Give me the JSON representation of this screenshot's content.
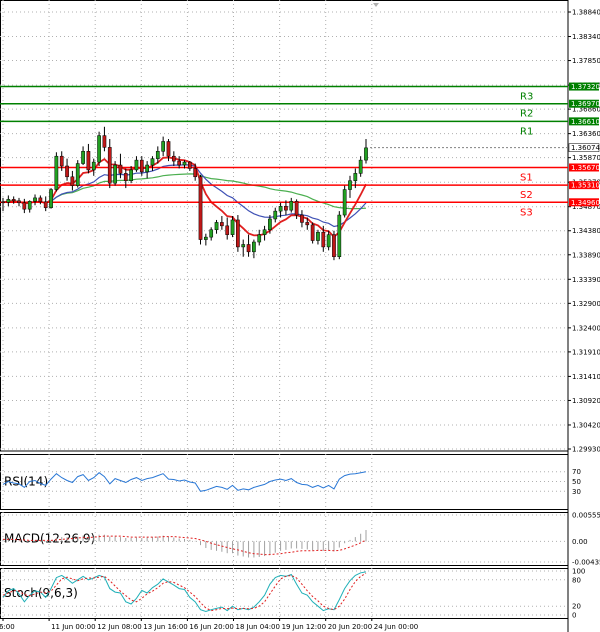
{
  "chart_data": {
    "type": "candlestick",
    "price_axis": {
      "ticks": [
        "1.38840",
        "1.38340",
        "1.37850",
        "1.37350",
        "1.36860",
        "1.36360",
        "1.35870",
        "1.35370",
        "1.34870",
        "1.34380",
        "1.33890",
        "1.33390",
        "1.32900",
        "1.32400",
        "1.31910",
        "1.31410",
        "1.30920",
        "1.30420",
        "1.29930"
      ],
      "ylim": [
        1.2993,
        1.3884
      ]
    },
    "time_axis": {
      "ticks": [
        "6:00",
        "11 Jun 00:00",
        "12 Jun 08:00",
        "13 Jun 16:00",
        "16 Jun 20:00",
        "18 Jun 04:00",
        "19 Jun 12:00",
        "20 Jun 20:00",
        "24 Jun 00:00"
      ]
    },
    "current_price": "1.36074",
    "levels": [
      {
        "name": "R3",
        "price": 1.3732,
        "label": "1.37320",
        "color": "#008000"
      },
      {
        "name": "R2",
        "price": 1.3697,
        "label": "1.36970",
        "color": "#008000"
      },
      {
        "name": "R1",
        "price": 1.3661,
        "label": "1.36610",
        "color": "#008000"
      },
      {
        "name": "S1",
        "price": 1.3567,
        "label": "1.35670",
        "color": "#ff0000"
      },
      {
        "name": "S2",
        "price": 1.3531,
        "label": "1.35310",
        "color": "#ff0000"
      },
      {
        "name": "S3",
        "price": 1.3496,
        "label": "1.34960",
        "color": "#ff0000"
      }
    ],
    "candles": [
      [
        1.3497,
        1.3505,
        1.3478,
        1.3496
      ],
      [
        1.3496,
        1.351,
        1.3488,
        1.3502
      ],
      [
        1.3502,
        1.3508,
        1.3493,
        1.3499
      ],
      [
        1.3499,
        1.3505,
        1.3488,
        1.3495
      ],
      [
        1.3495,
        1.3503,
        1.3474,
        1.3482
      ],
      [
        1.3482,
        1.35,
        1.3475,
        1.3498
      ],
      [
        1.3498,
        1.3512,
        1.349,
        1.3505
      ],
      [
        1.3505,
        1.351,
        1.3492,
        1.3497
      ],
      [
        1.3497,
        1.3508,
        1.3478,
        1.3485
      ],
      [
        1.3485,
        1.3525,
        1.3483,
        1.3522
      ],
      [
        1.3522,
        1.3598,
        1.3518,
        1.359
      ],
      [
        1.359,
        1.36,
        1.356,
        1.357
      ],
      [
        1.357,
        1.3585,
        1.354,
        1.3548
      ],
      [
        1.3548,
        1.356,
        1.352,
        1.353
      ],
      [
        1.353,
        1.3582,
        1.3526,
        1.3575
      ],
      [
        1.3575,
        1.361,
        1.3572,
        1.36
      ],
      [
        1.36,
        1.3615,
        1.3555,
        1.3562
      ],
      [
        1.3562,
        1.3585,
        1.355,
        1.3578
      ],
      [
        1.3578,
        1.364,
        1.357,
        1.3632
      ],
      [
        1.3632,
        1.365,
        1.36,
        1.3608
      ],
      [
        1.3608,
        1.3625,
        1.3525,
        1.3535
      ],
      [
        1.3535,
        1.358,
        1.353,
        1.3572
      ],
      [
        1.3572,
        1.3595,
        1.3545,
        1.3555
      ],
      [
        1.3555,
        1.3565,
        1.3525,
        1.354
      ],
      [
        1.354,
        1.357,
        1.3535,
        1.3562
      ],
      [
        1.3562,
        1.359,
        1.3558,
        1.3582
      ],
      [
        1.3582,
        1.359,
        1.355,
        1.3558
      ],
      [
        1.3558,
        1.358,
        1.3545,
        1.3572
      ],
      [
        1.3572,
        1.359,
        1.356,
        1.3585
      ],
      [
        1.3585,
        1.361,
        1.3575,
        1.36
      ],
      [
        1.36,
        1.363,
        1.359,
        1.362
      ],
      [
        1.362,
        1.3625,
        1.358,
        1.359
      ],
      [
        1.359,
        1.36,
        1.357,
        1.358
      ],
      [
        1.358,
        1.359,
        1.3565,
        1.3572
      ],
      [
        1.3572,
        1.3582,
        1.3565,
        1.3578
      ],
      [
        1.3578,
        1.358,
        1.356,
        1.3565
      ],
      [
        1.3565,
        1.3575,
        1.354,
        1.3548
      ],
      [
        1.3548,
        1.3552,
        1.341,
        1.342
      ],
      [
        1.342,
        1.3432,
        1.3408,
        1.3425
      ],
      [
        1.3425,
        1.3445,
        1.3418,
        1.344
      ],
      [
        1.344,
        1.346,
        1.3432,
        1.3455
      ],
      [
        1.3455,
        1.3468,
        1.344,
        1.3448
      ],
      [
        1.3448,
        1.3465,
        1.342,
        1.343
      ],
      [
        1.343,
        1.3468,
        1.3425,
        1.346
      ],
      [
        1.346,
        1.347,
        1.3395,
        1.3405
      ],
      [
        1.3405,
        1.342,
        1.3385,
        1.341
      ],
      [
        1.341,
        1.343,
        1.3385,
        1.3395
      ],
      [
        1.3395,
        1.342,
        1.3382,
        1.3415
      ],
      [
        1.3415,
        1.344,
        1.3408,
        1.343
      ],
      [
        1.343,
        1.3448,
        1.3418,
        1.344
      ],
      [
        1.344,
        1.347,
        1.3432,
        1.3462
      ],
      [
        1.3462,
        1.3485,
        1.3455,
        1.3478
      ],
      [
        1.3478,
        1.3495,
        1.3465,
        1.3488
      ],
      [
        1.3488,
        1.35,
        1.347,
        1.348
      ],
      [
        1.348,
        1.3505,
        1.3475,
        1.3498
      ],
      [
        1.3498,
        1.3502,
        1.3462,
        1.347
      ],
      [
        1.347,
        1.348,
        1.3445,
        1.3455
      ],
      [
        1.3455,
        1.3465,
        1.344,
        1.345
      ],
      [
        1.345,
        1.3455,
        1.3412,
        1.3418
      ],
      [
        1.3418,
        1.344,
        1.341,
        1.3435
      ],
      [
        1.3435,
        1.3448,
        1.3395,
        1.3405
      ],
      [
        1.3405,
        1.3438,
        1.3398,
        1.343
      ],
      [
        1.343,
        1.3438,
        1.3378,
        1.3385
      ],
      [
        1.3385,
        1.3478,
        1.338,
        1.347
      ],
      [
        1.347,
        1.353,
        1.3465,
        1.3522
      ],
      [
        1.3522,
        1.355,
        1.3505,
        1.354
      ],
      [
        1.354,
        1.3565,
        1.3525,
        1.3555
      ],
      [
        1.3555,
        1.359,
        1.3548,
        1.3582
      ],
      [
        1.3582,
        1.3625,
        1.3575,
        1.3607
      ]
    ],
    "indicators": [
      {
        "name": "RSI(14)",
        "ticks": [
          "70",
          "50",
          "30"
        ],
        "ylim": [
          0,
          100
        ],
        "values": [
          44,
          50,
          47,
          45,
          38,
          50,
          52,
          46,
          42,
          55,
          66,
          58,
          52,
          48,
          60,
          64,
          52,
          58,
          68,
          60,
          45,
          56,
          52,
          48,
          54,
          58,
          52,
          56,
          58,
          62,
          66,
          55,
          54,
          51,
          53,
          49,
          47,
          30,
          32,
          36,
          40,
          38,
          34,
          42,
          32,
          35,
          33,
          38,
          41,
          44,
          50,
          53,
          55,
          52,
          56,
          48,
          44,
          43,
          38,
          42,
          37,
          42,
          35,
          55,
          62,
          65,
          66,
          68,
          70
        ]
      },
      {
        "name": "MACD(12,26,9)",
        "ticks": [
          "0.005556",
          "0.00",
          "-0.004356"
        ],
        "ylim": [
          -0.004356,
          0.005556
        ],
        "histogram": [
          0.0004,
          0.0003,
          0.0003,
          0.0002,
          0.0001,
          0.0001,
          0.0002,
          0.0002,
          0.0001,
          0.0002,
          0.0007,
          0.0009,
          0.0009,
          0.0008,
          0.001,
          0.0012,
          0.001,
          0.001,
          0.0014,
          0.0014,
          0.001,
          0.001,
          0.0009,
          0.0007,
          0.0007,
          0.0008,
          0.0007,
          0.0008,
          0.0009,
          0.001,
          0.0012,
          0.001,
          0.0008,
          0.0006,
          0.0005,
          0.0003,
          0.0001,
          -0.0008,
          -0.0014,
          -0.0018,
          -0.002,
          -0.0022,
          -0.0025,
          -0.0025,
          -0.003,
          -0.0032,
          -0.0034,
          -0.0034,
          -0.0033,
          -0.0031,
          -0.0028,
          -0.0024,
          -0.002,
          -0.0018,
          -0.0015,
          -0.0015,
          -0.0016,
          -0.0017,
          -0.0019,
          -0.0018,
          -0.002,
          -0.0019,
          -0.0021,
          -0.0013,
          -0.0004,
          0.0003,
          0.0009,
          0.0016,
          0.0024
        ],
        "signal": [
          0.0004,
          0.0004,
          0.0004,
          0.0003,
          0.0003,
          0.0002,
          0.0002,
          0.0002,
          0.0002,
          0.0002,
          0.0003,
          0.0004,
          0.0005,
          0.0006,
          0.0007,
          0.0008,
          0.0008,
          0.0009,
          0.001,
          0.0011,
          0.0011,
          0.0011,
          0.0011,
          0.001,
          0.0009,
          0.0009,
          0.0009,
          0.0009,
          0.0009,
          0.0009,
          0.001,
          0.001,
          0.001,
          0.0009,
          0.0008,
          0.0007,
          0.0006,
          0.0003,
          0.0,
          -0.0004,
          -0.0007,
          -0.001,
          -0.0013,
          -0.0016,
          -0.0018,
          -0.0021,
          -0.0024,
          -0.0026,
          -0.0027,
          -0.0028,
          -0.0028,
          -0.0027,
          -0.0026,
          -0.0024,
          -0.0023,
          -0.0021,
          -0.002,
          -0.002,
          -0.002,
          -0.0019,
          -0.0019,
          -0.0019,
          -0.002,
          -0.0019,
          -0.0016,
          -0.0012,
          -0.0008,
          -0.0003,
          0.0003
        ]
      },
      {
        "name": "Stoch(9,6,3)",
        "ticks": [
          "100",
          "80",
          "20",
          "0"
        ],
        "ylim": [
          0,
          100
        ],
        "main": [
          40,
          55,
          60,
          48,
          30,
          45,
          55,
          52,
          40,
          60,
          85,
          90,
          82,
          72,
          80,
          88,
          80,
          84,
          90,
          86,
          60,
          52,
          50,
          30,
          25,
          38,
          56,
          50,
          62,
          70,
          82,
          75,
          68,
          60,
          58,
          40,
          30,
          12,
          8,
          12,
          15,
          18,
          10,
          20,
          12,
          15,
          12,
          18,
          30,
          45,
          70,
          85,
          90,
          88,
          92,
          70,
          50,
          45,
          30,
          20,
          10,
          14,
          12,
          35,
          60,
          78,
          90,
          96,
          98
        ],
        "signal": [
          45,
          50,
          55,
          55,
          46,
          44,
          48,
          52,
          50,
          54,
          68,
          82,
          86,
          82,
          78,
          82,
          84,
          84,
          86,
          88,
          78,
          66,
          54,
          44,
          34,
          30,
          38,
          48,
          54,
          62,
          72,
          76,
          74,
          68,
          62,
          52,
          42,
          28,
          16,
          10,
          12,
          15,
          14,
          16,
          14,
          15,
          14,
          15,
          20,
          30,
          48,
          66,
          82,
          88,
          90,
          84,
          70,
          55,
          42,
          32,
          20,
          15,
          12,
          20,
          36,
          58,
          76,
          88,
          95
        ]
      }
    ]
  }
}
